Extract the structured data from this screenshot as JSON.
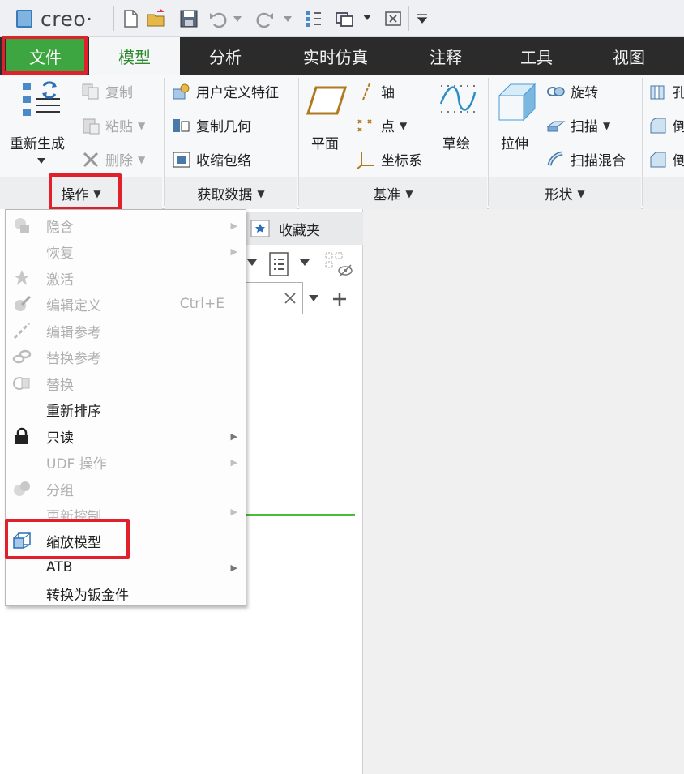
{
  "app": {
    "logo_text": "creo·"
  },
  "quick_access": {
    "icons": [
      "new-file-icon",
      "open-folder-icon",
      "save-icon",
      "undo-icon",
      "dropdown",
      "redo-icon",
      "dropdown",
      "regenerate-icon",
      "window-icon",
      "dropdown",
      "close-window-icon",
      "customize-dropdown-icon"
    ]
  },
  "tabs": [
    {
      "label": "文件",
      "active": false,
      "highlighted": true
    },
    {
      "label": "模型",
      "active": true
    },
    {
      "label": "分析"
    },
    {
      "label": "实时仿真"
    },
    {
      "label": "注释"
    },
    {
      "label": "工具"
    },
    {
      "label": "视图"
    }
  ],
  "ribbon": {
    "operations": {
      "regenerate": "重新生成",
      "copy": "复制",
      "paste": "粘贴",
      "delete": "删除",
      "footer": "操作"
    },
    "get_data": {
      "udf": "用户定义特征",
      "copy_geom": "复制几何",
      "shrinkwrap": "收缩包络",
      "footer": "获取数据"
    },
    "datum": {
      "plane": "平面",
      "axis": "轴",
      "point": "点",
      "csys": "坐标系",
      "sketch": "草绘",
      "footer": "基准"
    },
    "shapes": {
      "extrude": "拉伸",
      "revolve": "旋转",
      "sweep": "扫描",
      "swept_blend": "扫描混合",
      "footer": "形状"
    },
    "partial": {
      "item1": "孔",
      "item2": "倒",
      "item3": "倒"
    }
  },
  "favorites_tab": "收藏夹",
  "menu": {
    "items": [
      {
        "label": "隐含",
        "enabled": false,
        "submenu": true,
        "icon": "suppress-icon"
      },
      {
        "label": "恢复",
        "enabled": false,
        "submenu": true,
        "icon": ""
      },
      {
        "label": "激活",
        "enabled": false,
        "submenu": false,
        "icon": "activate-icon"
      },
      {
        "label": "编辑定义",
        "enabled": false,
        "submenu": false,
        "icon": "edit-definition-icon",
        "shortcut": "Ctrl+E"
      },
      {
        "label": "编辑参考",
        "enabled": false,
        "submenu": false,
        "icon": "edit-references-icon"
      },
      {
        "label": "替换参考",
        "enabled": false,
        "submenu": false,
        "icon": "replace-references-icon"
      },
      {
        "label": "替换",
        "enabled": false,
        "submenu": false,
        "icon": "replace-icon"
      },
      {
        "label": "重新排序",
        "enabled": true,
        "submenu": false,
        "icon": ""
      },
      {
        "label": "只读",
        "enabled": true,
        "submenu": true,
        "icon": "lock-icon"
      },
      {
        "label": "UDF 操作",
        "enabled": false,
        "submenu": true,
        "icon": ""
      },
      {
        "label": "分组",
        "enabled": false,
        "submenu": false,
        "icon": "group-icon"
      },
      {
        "label": "更新控制",
        "enabled": false,
        "submenu": true,
        "icon": ""
      },
      {
        "label": "缩放模型",
        "enabled": true,
        "submenu": false,
        "icon": "scale-model-icon",
        "highlighted": true
      },
      {
        "label": "ATB",
        "enabled": true,
        "submenu": true,
        "icon": ""
      },
      {
        "label": "转换为钣金件",
        "enabled": true,
        "submenu": false,
        "icon": ""
      }
    ]
  },
  "colors": {
    "file_tab": "#3ea641",
    "tab_bar": "#2b2b2b",
    "highlight_box": "#e0202a",
    "model_tab_text": "#2f8a2f",
    "progress_line": "#4cbb3a"
  }
}
